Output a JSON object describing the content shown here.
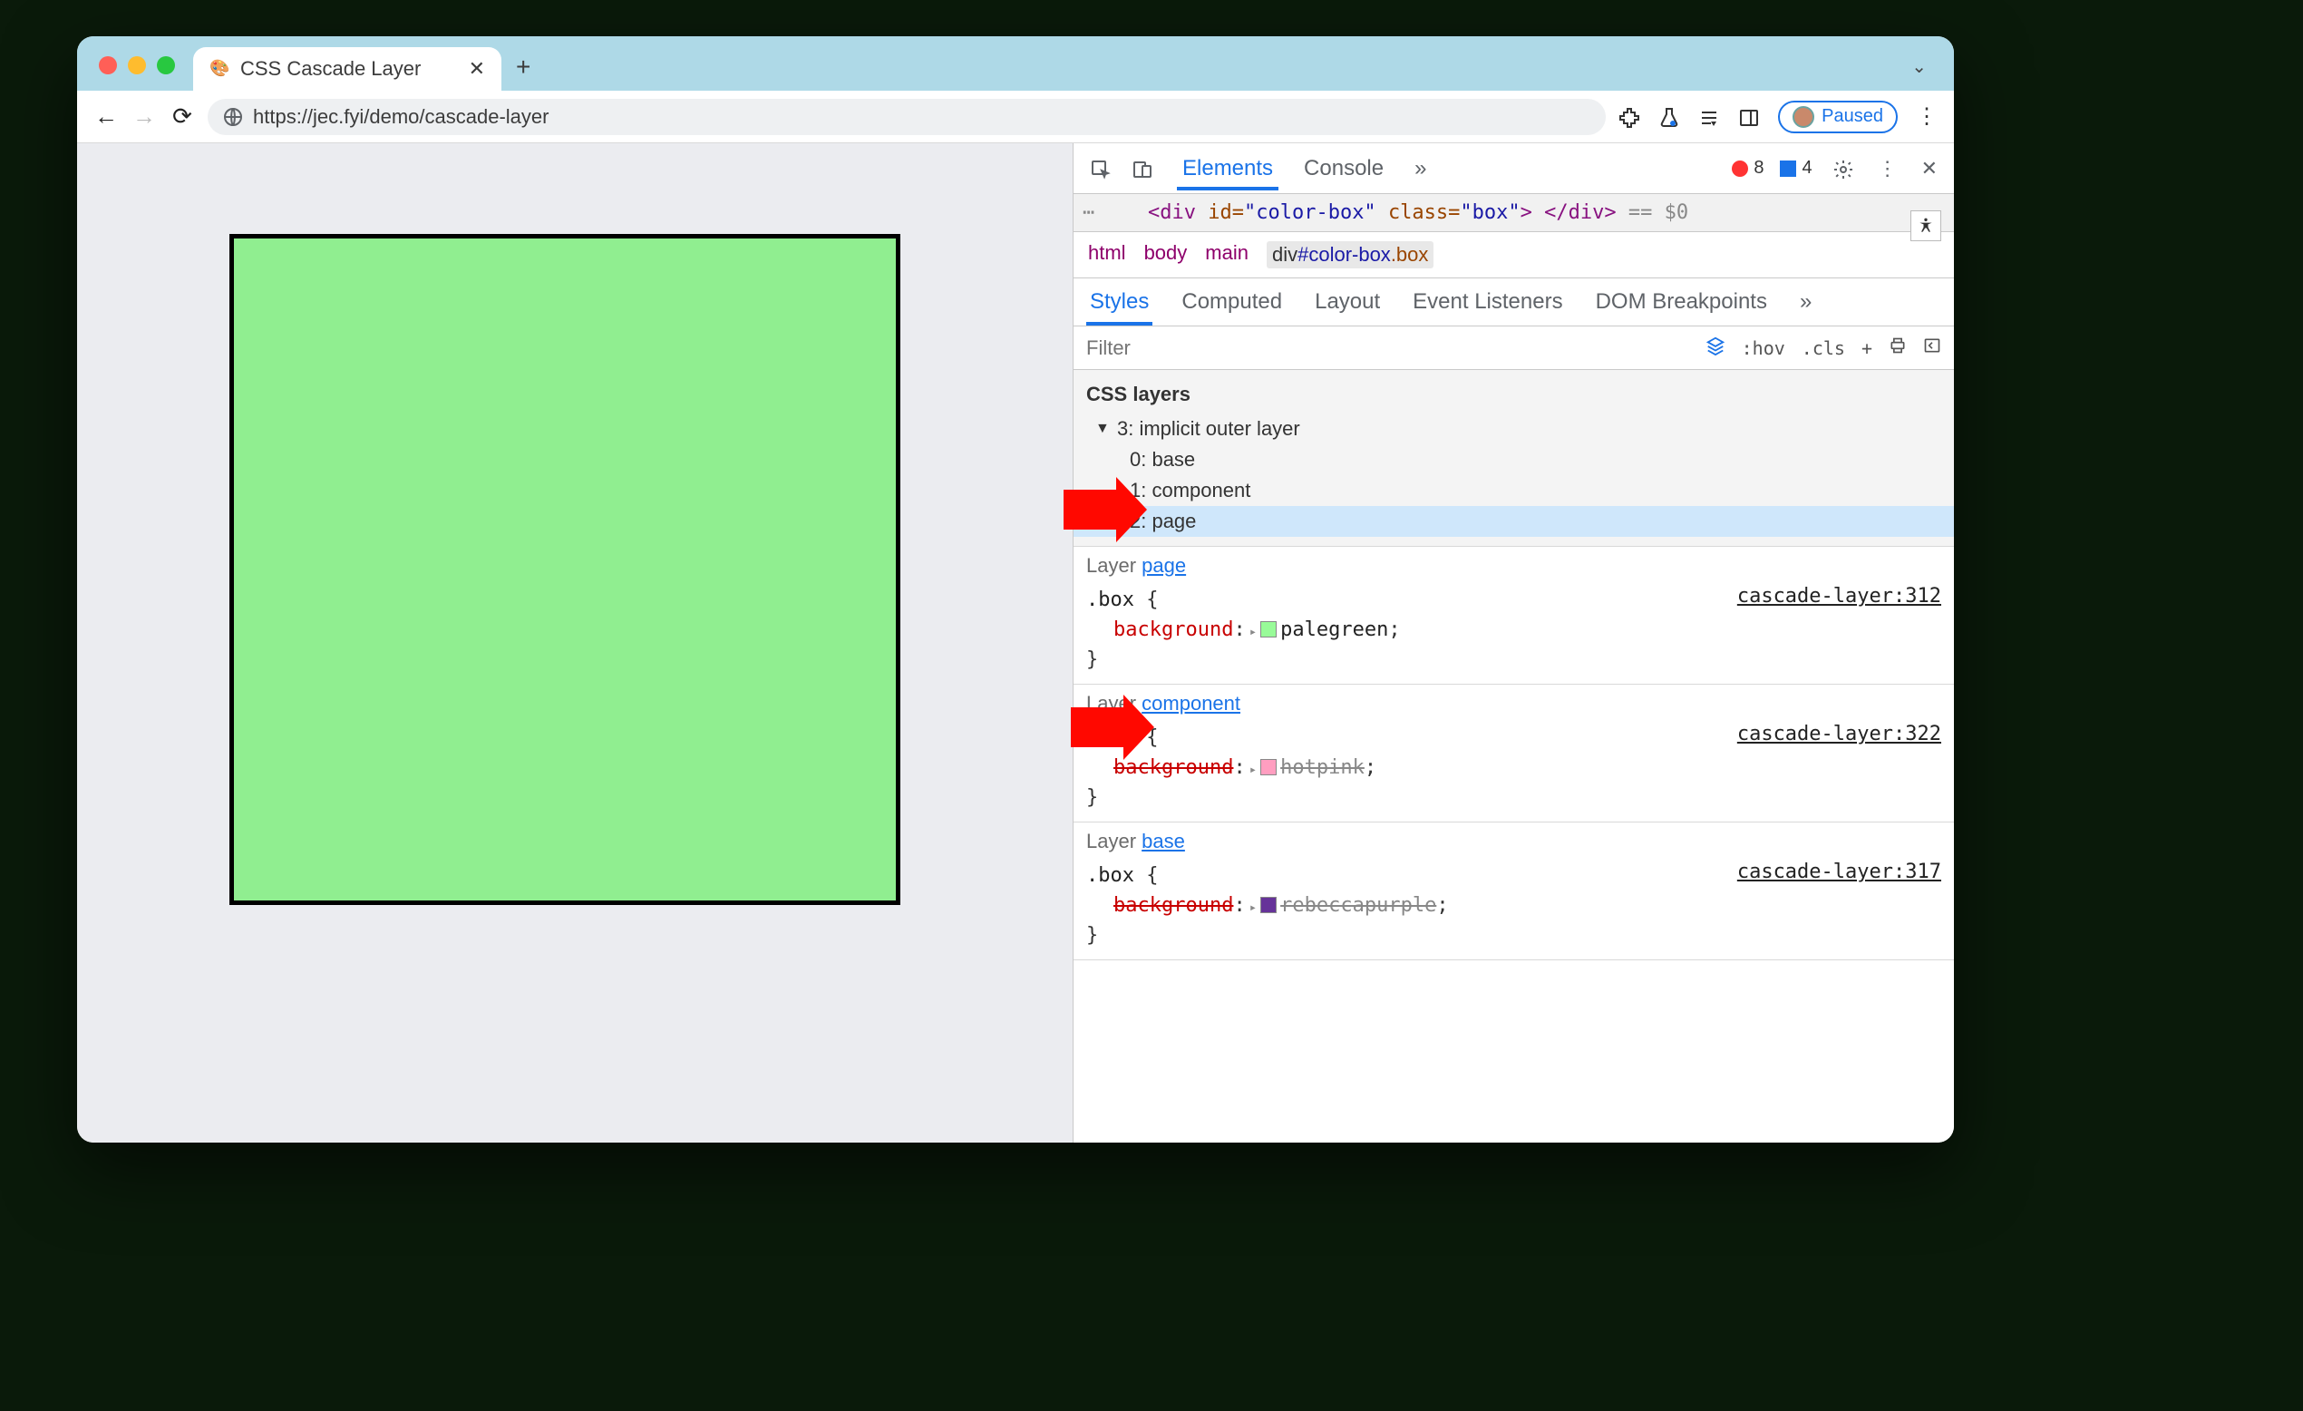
{
  "tab": {
    "title": "CSS Cascade Layer"
  },
  "url": "https://jec.fyi/demo/cascade-layer",
  "paused_label": "Paused",
  "demo": {
    "box_color": "#90ee90"
  },
  "devtools": {
    "panel_tabs": {
      "elements": "Elements",
      "console": "Console"
    },
    "counts": {
      "errors": "8",
      "issues": "4"
    },
    "dom_line": {
      "prefix": "<div",
      "id_attr": "id=",
      "id_val": "\"color-box\"",
      "class_attr": "class=",
      "class_val": "\"box\"",
      "suffix": "> </div>",
      "eq": "== $0"
    },
    "breadcrumb": [
      "html",
      "body",
      "main",
      "div#color-box.box"
    ],
    "styles_tabs": [
      "Styles",
      "Computed",
      "Layout",
      "Event Listeners",
      "DOM Breakpoints"
    ],
    "filter_placeholder": "Filter",
    "filter_tools": {
      "hov": ":hov",
      "cls": ".cls",
      "plus": "+"
    },
    "css_layers": {
      "header": "CSS layers",
      "parent": "3: implicit outer layer",
      "children": [
        "0: base",
        "1: component",
        "2: page"
      ],
      "highlighted_index": 2
    },
    "rules": [
      {
        "layer_label_prefix": "Layer ",
        "layer_link": "page",
        "selector": ".box",
        "prop": "background",
        "value": "palegreen",
        "swatch": "#98fb98",
        "struck": false,
        "source": "cascade-layer:312"
      },
      {
        "layer_label_prefix": "Layer ",
        "layer_link": "component",
        "selector": ".box",
        "prop": "background",
        "value": "hotpink",
        "swatch": "#ff9ec0",
        "struck": true,
        "source": "cascade-layer:322"
      },
      {
        "layer_label_prefix": "Layer ",
        "layer_link": "base",
        "selector": ".box",
        "prop": "background",
        "value": "rebeccapurple",
        "swatch": "#663399",
        "struck": true,
        "source": "cascade-layer:317"
      }
    ]
  }
}
